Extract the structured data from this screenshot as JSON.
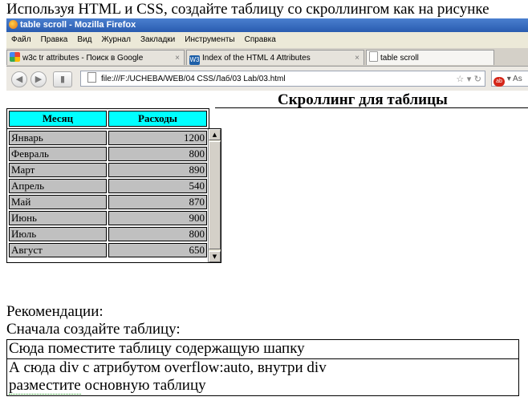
{
  "task_text": "Используя HTML и CSS, создайте таблицу со скроллингом как на рисунке",
  "browser": {
    "window_title": "table scroll - Mozilla Firefox",
    "menu": [
      "Файл",
      "Правка",
      "Вид",
      "Журнал",
      "Закладки",
      "Инструменты",
      "Справка"
    ],
    "tabs": [
      {
        "label": "w3c tr attributes - Поиск в Google",
        "icon": "google-icon"
      },
      {
        "label": "Index of the HTML 4 Attributes",
        "icon": "w3c-icon"
      },
      {
        "label": "table scroll",
        "icon": "page-icon"
      }
    ],
    "tab_close": "×",
    "url": "file:///F:/UCHEBA/WEB/04 CSS/Лаб/03 Lab/03.html",
    "search_placeholder": "As"
  },
  "page": {
    "heading": "Скроллинг для таблицы",
    "table": {
      "headers": [
        "Месяц",
        "Расходы"
      ],
      "header_color": "#00ffff",
      "cell_color": "#c0c0c0",
      "rows": [
        [
          "Январь",
          "1200"
        ],
        [
          "Февраль",
          "800"
        ],
        [
          "Март",
          "890"
        ],
        [
          "Апрель",
          "540"
        ],
        [
          "Май",
          "870"
        ],
        [
          "Июнь",
          "900"
        ],
        [
          "Июль",
          "800"
        ],
        [
          "Август",
          "650"
        ]
      ]
    }
  },
  "recommendations": {
    "title": "Рекомендации:",
    "first": "Сначала создайте таблицу:",
    "row1": "Сюда поместите таблицу содержащую шапку",
    "row2_line1": "А сюда div с атрибутом overflow:auto, внутри div",
    "row2_line2_a": "разместите",
    "row2_line2_b": " основную таблицу"
  }
}
